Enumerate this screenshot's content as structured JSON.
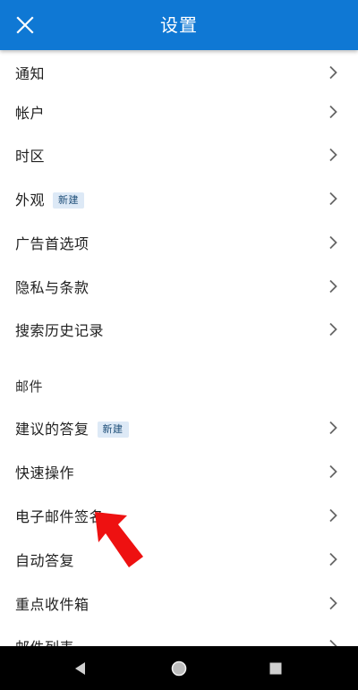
{
  "header": {
    "title": "设置",
    "close_icon": "close-icon"
  },
  "settings": {
    "items": [
      {
        "label": "通知"
      },
      {
        "label": "帐户"
      },
      {
        "label": "时区"
      },
      {
        "label": "外观",
        "badge": "新建"
      },
      {
        "label": "广告首选项"
      },
      {
        "label": "隐私与条款"
      },
      {
        "label": "搜索历史记录"
      }
    ]
  },
  "mail_section": {
    "title": "邮件",
    "items": [
      {
        "label": "建议的答复",
        "badge": "新建"
      },
      {
        "label": "快速操作"
      },
      {
        "label": "电子邮件签名"
      },
      {
        "label": "自动答复"
      },
      {
        "label": "重点收件箱"
      },
      {
        "label": "邮件列表"
      }
    ]
  },
  "navbar": {
    "back_icon": "back-triangle-icon",
    "home_icon": "home-circle-icon",
    "recents_icon": "recents-square-icon"
  },
  "colors": {
    "header_bg": "#0f78d4",
    "header_text": "#ffffff",
    "badge_bg": "#dde9f6",
    "badge_text": "#1e4e78",
    "annotation_arrow": "#ee1111",
    "navbar_bg": "#000000"
  }
}
